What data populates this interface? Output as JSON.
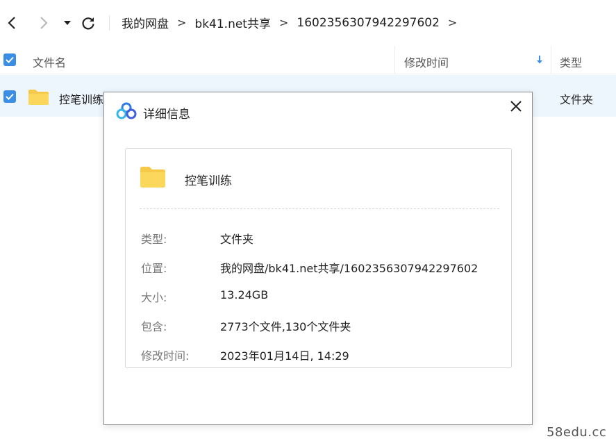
{
  "breadcrumb": [
    "我的网盘",
    "bk41.net共享",
    "1602356307942297602"
  ],
  "breadcrumb_separator": ">",
  "columns": {
    "name": "文件名",
    "modified": "修改时间",
    "type": "类型"
  },
  "file_row": {
    "name": "控笔训练",
    "type": "文件夹"
  },
  "dialog": {
    "title": "详细信息",
    "item_name": "控笔训练",
    "rows": [
      {
        "label": "类型:",
        "value": "文件夹"
      },
      {
        "label": "位置:",
        "value": "我的网盘/bk41.net共享/1602356307942297602"
      },
      {
        "label": "大小:",
        "value": "13.24GB"
      },
      {
        "label": "包含:",
        "value": "2773个文件,130个文件夹"
      },
      {
        "label": "修改时间:",
        "value": "2023年01月14日, 14:29"
      }
    ]
  },
  "watermark": "58edu.cc",
  "icons": {
    "back": "chevron-left-icon",
    "forward": "chevron-right-icon",
    "dropdown": "caret-down-icon",
    "refresh": "refresh-icon",
    "sort": "arrow-down-icon",
    "folder": "folder-icon",
    "logo": "cloud-logo-icon",
    "close": "close-icon"
  },
  "colors": {
    "accent": "#3a8ee6",
    "selected_row": "#eef6fd",
    "folder": "#f7c948"
  }
}
